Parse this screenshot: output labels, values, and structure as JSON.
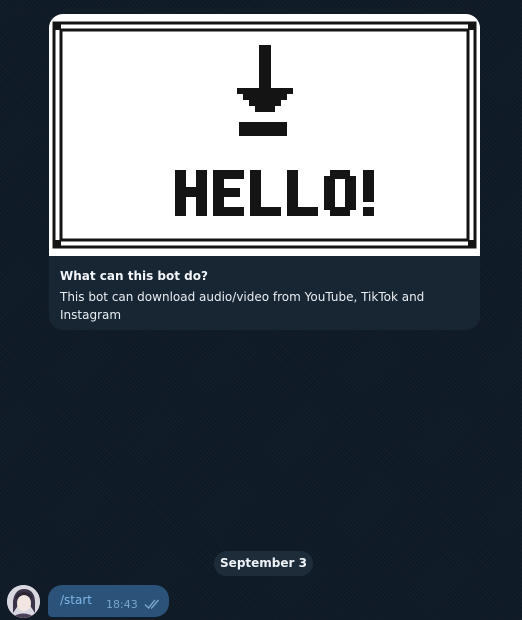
{
  "bot_info": {
    "banner_text": "HELLO!",
    "title": "What can this bot do?",
    "description": "This bot can download audio/video from YouTube, TikTok and Instagram"
  },
  "date_separator": "September 3",
  "messages": [
    {
      "direction": "outgoing",
      "text": "/start",
      "time": "18:43",
      "status_icon": "double-check-icon"
    }
  ],
  "colors": {
    "chat_background": "#101b28",
    "card_background": "#182533",
    "outgoing_bubble": "#2b5278",
    "command_text": "#7fb6ea"
  }
}
